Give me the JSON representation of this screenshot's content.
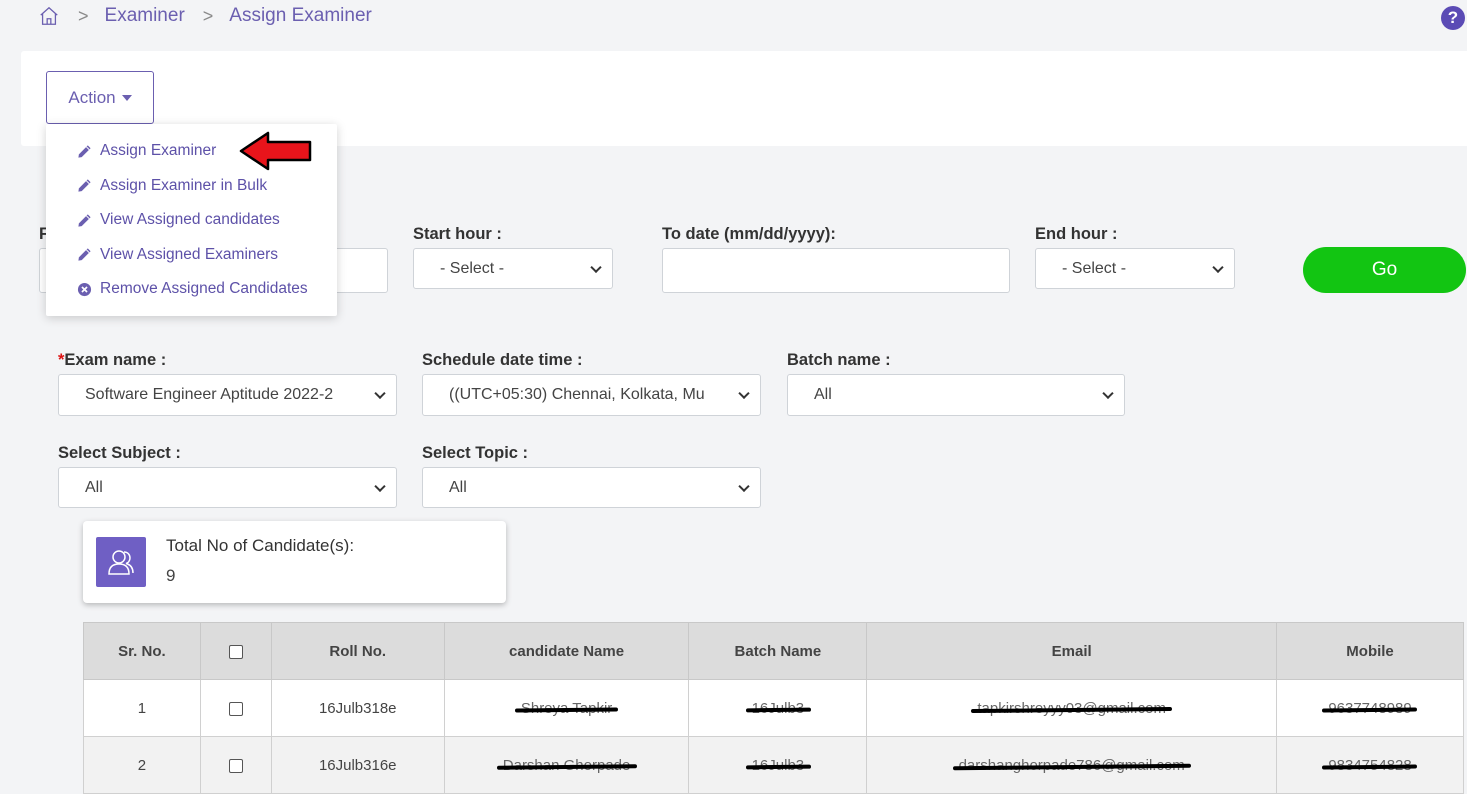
{
  "breadcrumb": {
    "items": [
      "Examiner",
      "Assign Examiner"
    ]
  },
  "help": {
    "glyph": "?"
  },
  "action": {
    "label": "Action",
    "menu": [
      {
        "label": "Assign Examiner",
        "icon": "pencil-icon"
      },
      {
        "label": "Assign Examiner in Bulk",
        "icon": "pencil-icon"
      },
      {
        "label": "View Assigned candidates",
        "icon": "pencil-icon"
      },
      {
        "label": "View Assigned Examiners",
        "icon": "pencil-icon"
      },
      {
        "label": "Remove Assigned Candidates",
        "icon": "x-circle-icon"
      }
    ]
  },
  "filters": {
    "from_label_partial": "F",
    "start_hour_label": "Start hour :",
    "start_hour_value": "- Select -",
    "to_date_label": "To date (mm/dd/yyyy):",
    "to_date_value": "",
    "end_hour_label": "End hour :",
    "end_hour_value": "- Select -",
    "go_label": "Go"
  },
  "exam": {
    "required_mark": "*",
    "exam_name_label": "Exam name :",
    "exam_name_value": "Software Engineer Aptitude 2022-2",
    "schedule_label": "Schedule date time :",
    "schedule_value": "((UTC+05:30) Chennai, Kolkata, Mu",
    "batch_label": "Batch name :",
    "batch_value": "All",
    "subject_label": "Select Subject :",
    "subject_value": "All",
    "topic_label": "Select Topic :",
    "topic_value": "All"
  },
  "total": {
    "label": "Total No of Candidate(s):",
    "value": "9"
  },
  "table": {
    "headers": [
      "Sr. No.",
      "",
      "Roll No.",
      "candidate Name",
      "Batch Name",
      "Email",
      "Mobile"
    ],
    "rows": [
      {
        "sr": "1",
        "roll": "16Julb318e",
        "name": "Shreya Tapkir",
        "batch": "16Julb3",
        "email": "tapkirshreyyy03@gmail.com",
        "mobile": "9637748989"
      },
      {
        "sr": "2",
        "roll": "16Julb316e",
        "name": "Darshan Ghorpade",
        "batch": "16Julb3",
        "email": "darshanghorpade786@gmail.com",
        "mobile": "9834754828"
      }
    ]
  },
  "colors": {
    "accent": "#6b5fb0",
    "go": "#12c512",
    "arrow": "#e8141b"
  }
}
